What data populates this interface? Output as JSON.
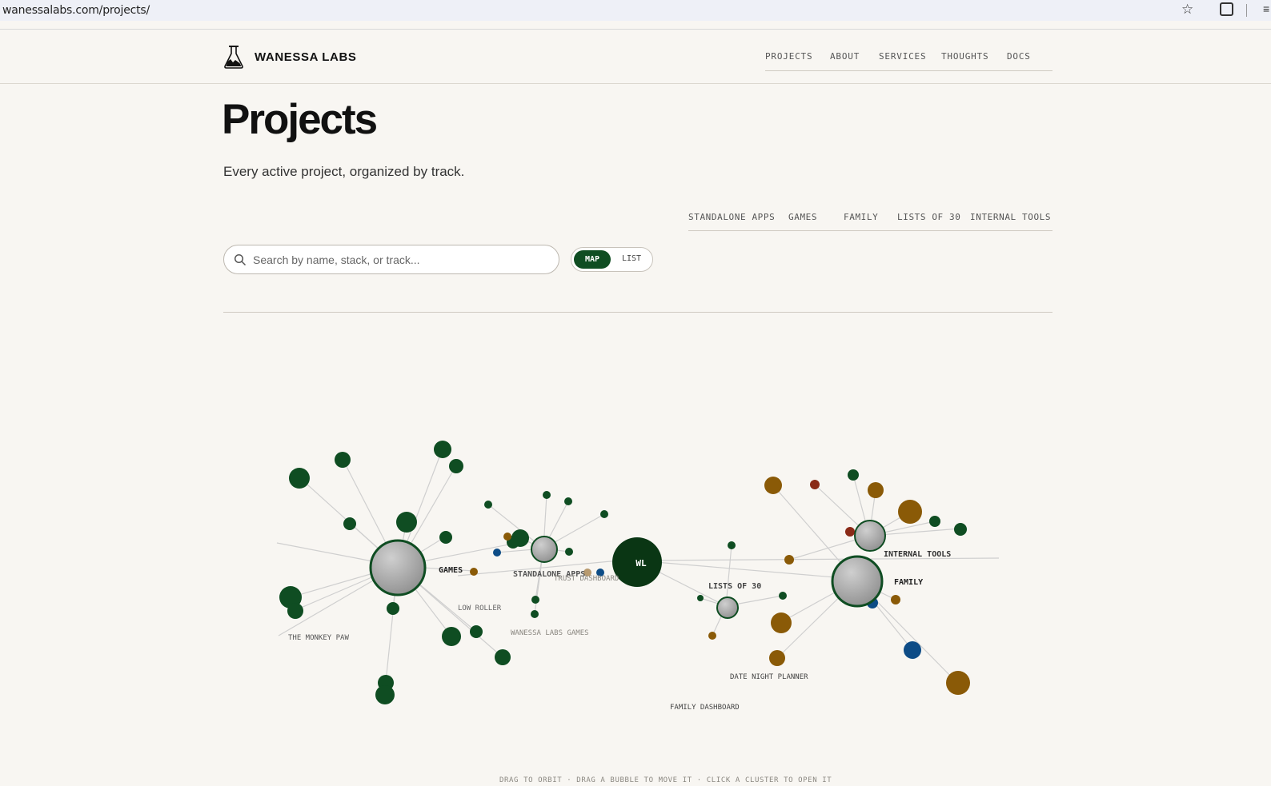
{
  "browser": {
    "url": "wanessalabs.com/projects/"
  },
  "site": {
    "brand": "WANESSA LABS",
    "nav": [
      "PROJECTS",
      "ABOUT",
      "SERVICES",
      "THOUGHTS",
      "DOCS"
    ]
  },
  "page": {
    "title": "Projects",
    "subtitle": "Every active project, organized by track."
  },
  "tracks": [
    "STANDALONE APPS",
    "GAMES",
    "FAMILY",
    "LISTS OF 30",
    "INTERNAL TOOLS"
  ],
  "search": {
    "placeholder": "Search by name, stack, or track..."
  },
  "view_toggle": {
    "active": "MAP",
    "inactive": "LIST"
  },
  "map": {
    "hub_label": "WL",
    "clusters": [
      "GAMES",
      "STANDALONE APPS",
      "LISTS OF 30",
      "INTERNAL TOOLS",
      "FAMILY"
    ],
    "project_labels": [
      "LOW ROLLER",
      "THE MONKEY PAW",
      "TRUST DASHBOARD",
      "WANESSA LABS GAMES",
      "DATE NIGHT PLANNER",
      "FAMILY DASHBOARD"
    ],
    "colors": {
      "green": "#0f4d22",
      "gold": "#8a5a07",
      "blue": "#0d4c86",
      "red": "#8a2a17",
      "hub": "#0a3614"
    },
    "hint": "DRAG TO ORBIT · DRAG A BUBBLE TO MOVE IT · CLICK A CLUSTER TO OPEN IT"
  }
}
